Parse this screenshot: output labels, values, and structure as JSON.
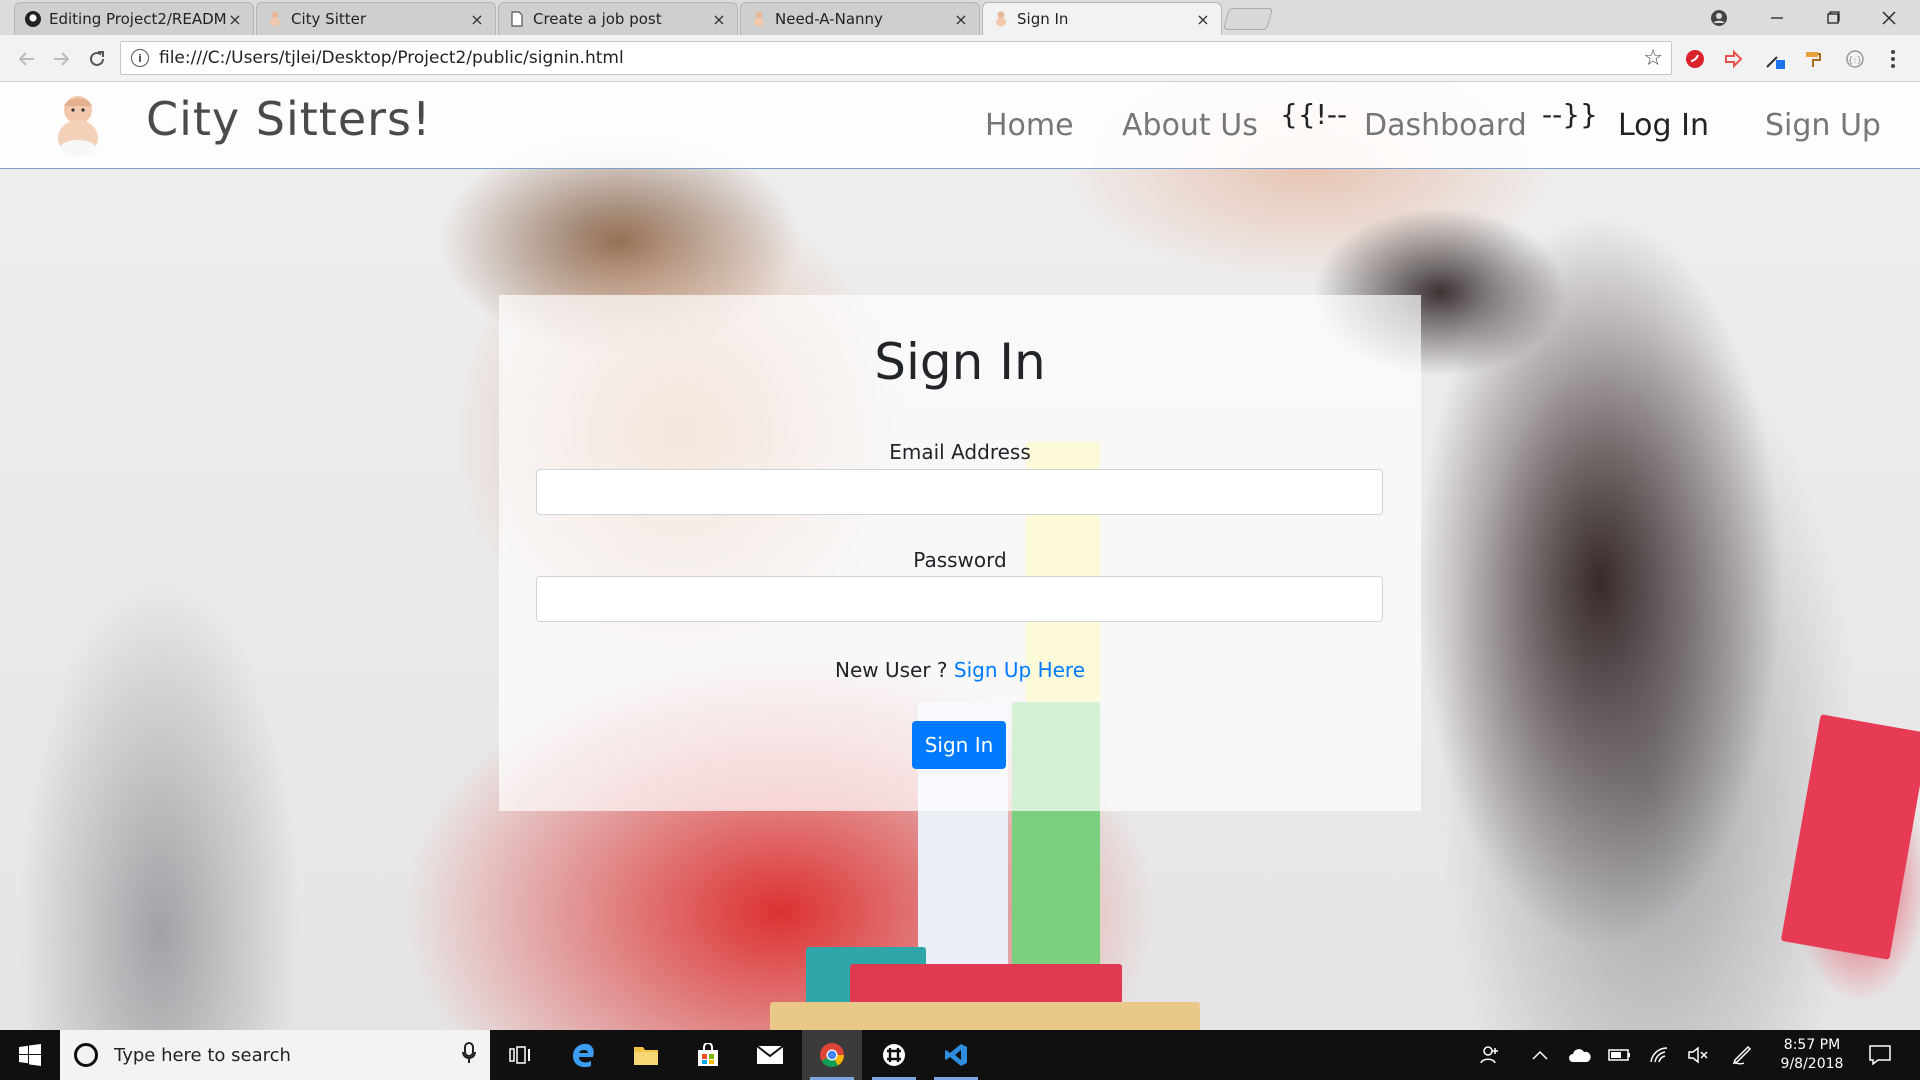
{
  "browser": {
    "tabs": [
      {
        "title": "Editing Project2/README",
        "icon": "github-icon"
      },
      {
        "title": "City Sitter",
        "icon": "baby-icon"
      },
      {
        "title": "Create a job post",
        "icon": "page-icon"
      },
      {
        "title": "Need-A-Nanny",
        "icon": "baby-icon"
      },
      {
        "title": "Sign In",
        "icon": "baby-icon",
        "active": true
      }
    ],
    "close_glyph": "×",
    "url": "file:///C:/Users/tjlei/Desktop/Project2/public/signin.html"
  },
  "navbar": {
    "brand": "City Sitters!",
    "links": {
      "home": "Home",
      "about": "About Us",
      "comment_open": "{{!--",
      "dashboard": "Dashboard",
      "comment_close": "--}}",
      "login": "Log In",
      "signup": "Sign Up"
    }
  },
  "signin": {
    "title": "Sign In",
    "email_label": "Email Address",
    "email_value": "",
    "password_label": "Password",
    "password_value": "",
    "new_user_text": "New User ?",
    "signup_link": "Sign Up Here",
    "submit_label": "Sign In"
  },
  "taskbar": {
    "search_placeholder": "Type here to search",
    "time": "8:57 PM",
    "date": "9/8/2018"
  },
  "colors": {
    "primary": "#007bff",
    "taskbar": "#101010"
  }
}
